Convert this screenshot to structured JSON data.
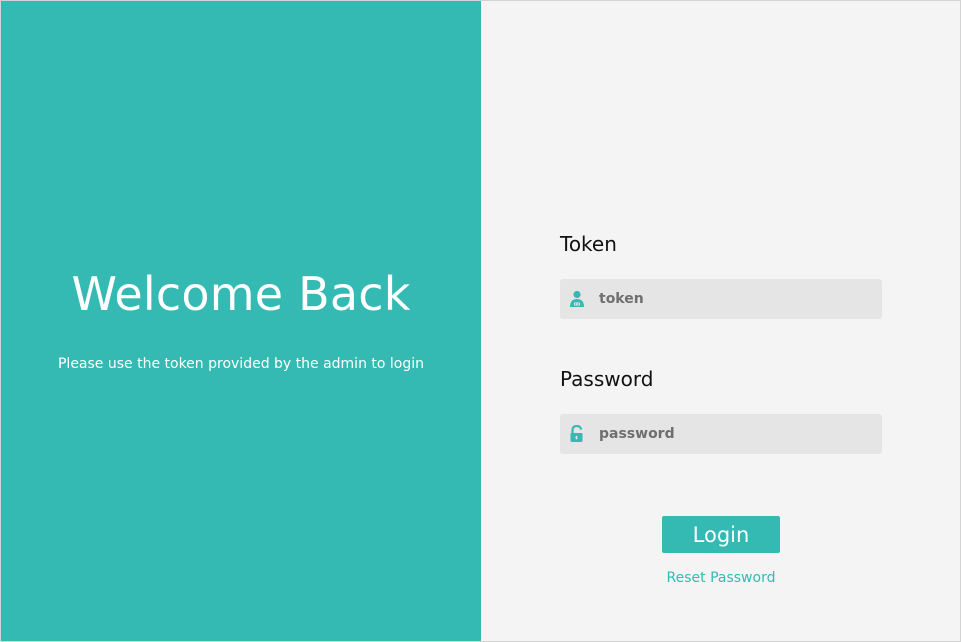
{
  "welcome": {
    "title": "Welcome Back",
    "subtitle": "Please use the token provided by the admin to login"
  },
  "form": {
    "token_label": "Token",
    "token_placeholder": "token",
    "token_value": "",
    "token_icon": "user-badge-icon",
    "password_label": "Password",
    "password_placeholder": "password",
    "password_value": "",
    "password_icon": "unlock-icon",
    "login_label": "Login",
    "reset_label": "Reset Password"
  },
  "colors": {
    "accent": "#34bab3",
    "panel_background": "#f4f4f4",
    "input_background": "#e5e5e5"
  }
}
